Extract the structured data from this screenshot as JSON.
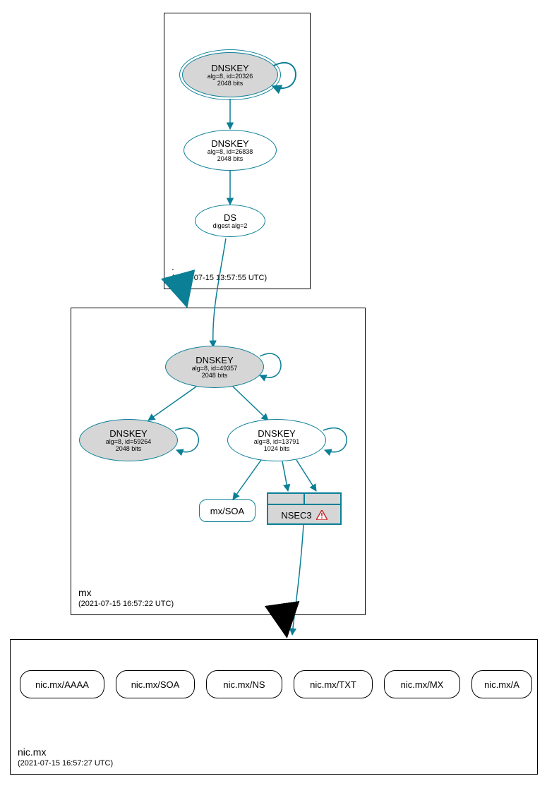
{
  "zones": {
    "root": {
      "label": ".",
      "timestamp": "(2021-07-15 13:57:55 UTC)"
    },
    "mx": {
      "label": "mx",
      "timestamp": "(2021-07-15 16:57:22 UTC)"
    },
    "nicmx": {
      "label": "nic.mx",
      "timestamp": "(2021-07-15 16:57:27 UTC)"
    }
  },
  "nodes": {
    "root_ksk": {
      "title": "DNSKEY",
      "line1": "alg=8, id=20326",
      "line2": "2048 bits"
    },
    "root_zsk": {
      "title": "DNSKEY",
      "line1": "alg=8, id=26838",
      "line2": "2048 bits"
    },
    "root_ds": {
      "title": "DS",
      "line1": "digest alg=2"
    },
    "mx_ksk": {
      "title": "DNSKEY",
      "line1": "alg=8, id=49357",
      "line2": "2048 bits"
    },
    "mx_zsk2": {
      "title": "DNSKEY",
      "line1": "alg=8, id=59264",
      "line2": "2048 bits"
    },
    "mx_zsk1": {
      "title": "DNSKEY",
      "line1": "alg=8, id=13791",
      "line2": "1024 bits"
    },
    "mx_soa": {
      "label": "mx/SOA"
    },
    "nsec3": {
      "label": "NSEC3"
    },
    "rr_aaaa": {
      "label": "nic.mx/AAAA"
    },
    "rr_soa": {
      "label": "nic.mx/SOA"
    },
    "rr_ns": {
      "label": "nic.mx/NS"
    },
    "rr_txt": {
      "label": "nic.mx/TXT"
    },
    "rr_mx": {
      "label": "nic.mx/MX"
    },
    "rr_a": {
      "label": "nic.mx/A"
    }
  },
  "colors": {
    "teal": "#0a7f96",
    "grey": "#d6d6d6",
    "warn": "#c62828"
  }
}
